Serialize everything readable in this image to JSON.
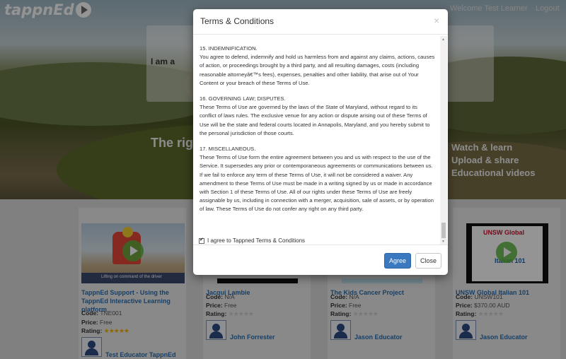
{
  "header": {
    "logo_text": "tappnEd",
    "welcome": "Welcome Test Learner",
    "logout": "Logout"
  },
  "hero": {
    "iam_label": "I am a",
    "tagline": "The rig",
    "features": [
      "Watch & learn",
      "Upload & share",
      "Educational videos"
    ]
  },
  "courses": [
    {
      "title": "TappnEd Support - Using the TappnEd Interactive Learning platform",
      "thumb_caption": "Lifting on command of the driver",
      "code_label": "Code:",
      "code": "TNE001",
      "price_label": "Price:",
      "price": "Free",
      "rating_label": "Rating:",
      "rating": 5,
      "educator": "Test Educator TappnEd"
    },
    {
      "title": "Jacqui Lambie",
      "code_label": "Code:",
      "code": "N/A",
      "price_label": "Price:",
      "price": "Free",
      "rating_label": "Rating:",
      "rating": 0,
      "educator": "John Forrester"
    },
    {
      "title": "The Kids Cancer Project",
      "code_label": "Code:",
      "code": "N/A",
      "price_label": "Price:",
      "price": "Free",
      "rating_label": "Rating:",
      "rating": 0,
      "educator": "Jason Educator"
    },
    {
      "title": "UNSW Global Italian 101",
      "thumb_caption": "UNSW Global",
      "thumb_sub": "Italian 101",
      "code_label": "Code:",
      "code": "UNSW101",
      "price_label": "Price:",
      "price": "$370.00 AUD",
      "rating_label": "Rating:",
      "rating": 0,
      "educator": "Jason Educator"
    }
  ],
  "modal": {
    "title": "Terms & Conditions",
    "close_glyph": "×",
    "sections": [
      {
        "heading": "15. INDEMNIFICATION.",
        "body": "You agree to defend, indemnify and hold us harmless from and against any claims, actions, causes of action, or proceedings brought by a third party, and all resulting damages, costs (including reasonable attorneyâ€™s fees), expenses, penalties and other liability, that arise out of Your Content or your breach of these Terms of Use."
      },
      {
        "heading": "16. GOVERNING LAW; DISPUTES.",
        "body": "These Terms of Use are governed by the laws of the State of Maryland, without regard to its conflict of laws rules. The exclusive venue for any action or dispute arising out of these Terms of Use will be the state and federal courts located in Annapolis, Maryland, and you hereby submit to the personal jurisdiction of those courts."
      },
      {
        "heading": "17. MISCELLANEOUS.",
        "body": "These Terms of Use form the entire agreement between you and us with respect to the use of the Service. It supersedes any prior or contemporaneous agreements or communications between us. If we fail to enforce any term of these Terms of Use, it will not be considered a waiver. Any amendment to these Terms of Use must be made in a writing signed by us or made in accordance with Section 1 of these Terms of Use. All of our rights under these Terms of Use are freely assignable by us, including in connection with a merger, acquisition, sale of assets, or by operation of law. These Terms of Use do not confer any right on any third party."
      }
    ],
    "checkbox_label": "I agree to Tappned Terms & Conditions",
    "checkbox_checked": true,
    "agree_label": "Agree",
    "close_label": "Close"
  },
  "colors": {
    "primary": "#3a78c0",
    "link": "#2a6fb0",
    "star": "#f0b400"
  }
}
